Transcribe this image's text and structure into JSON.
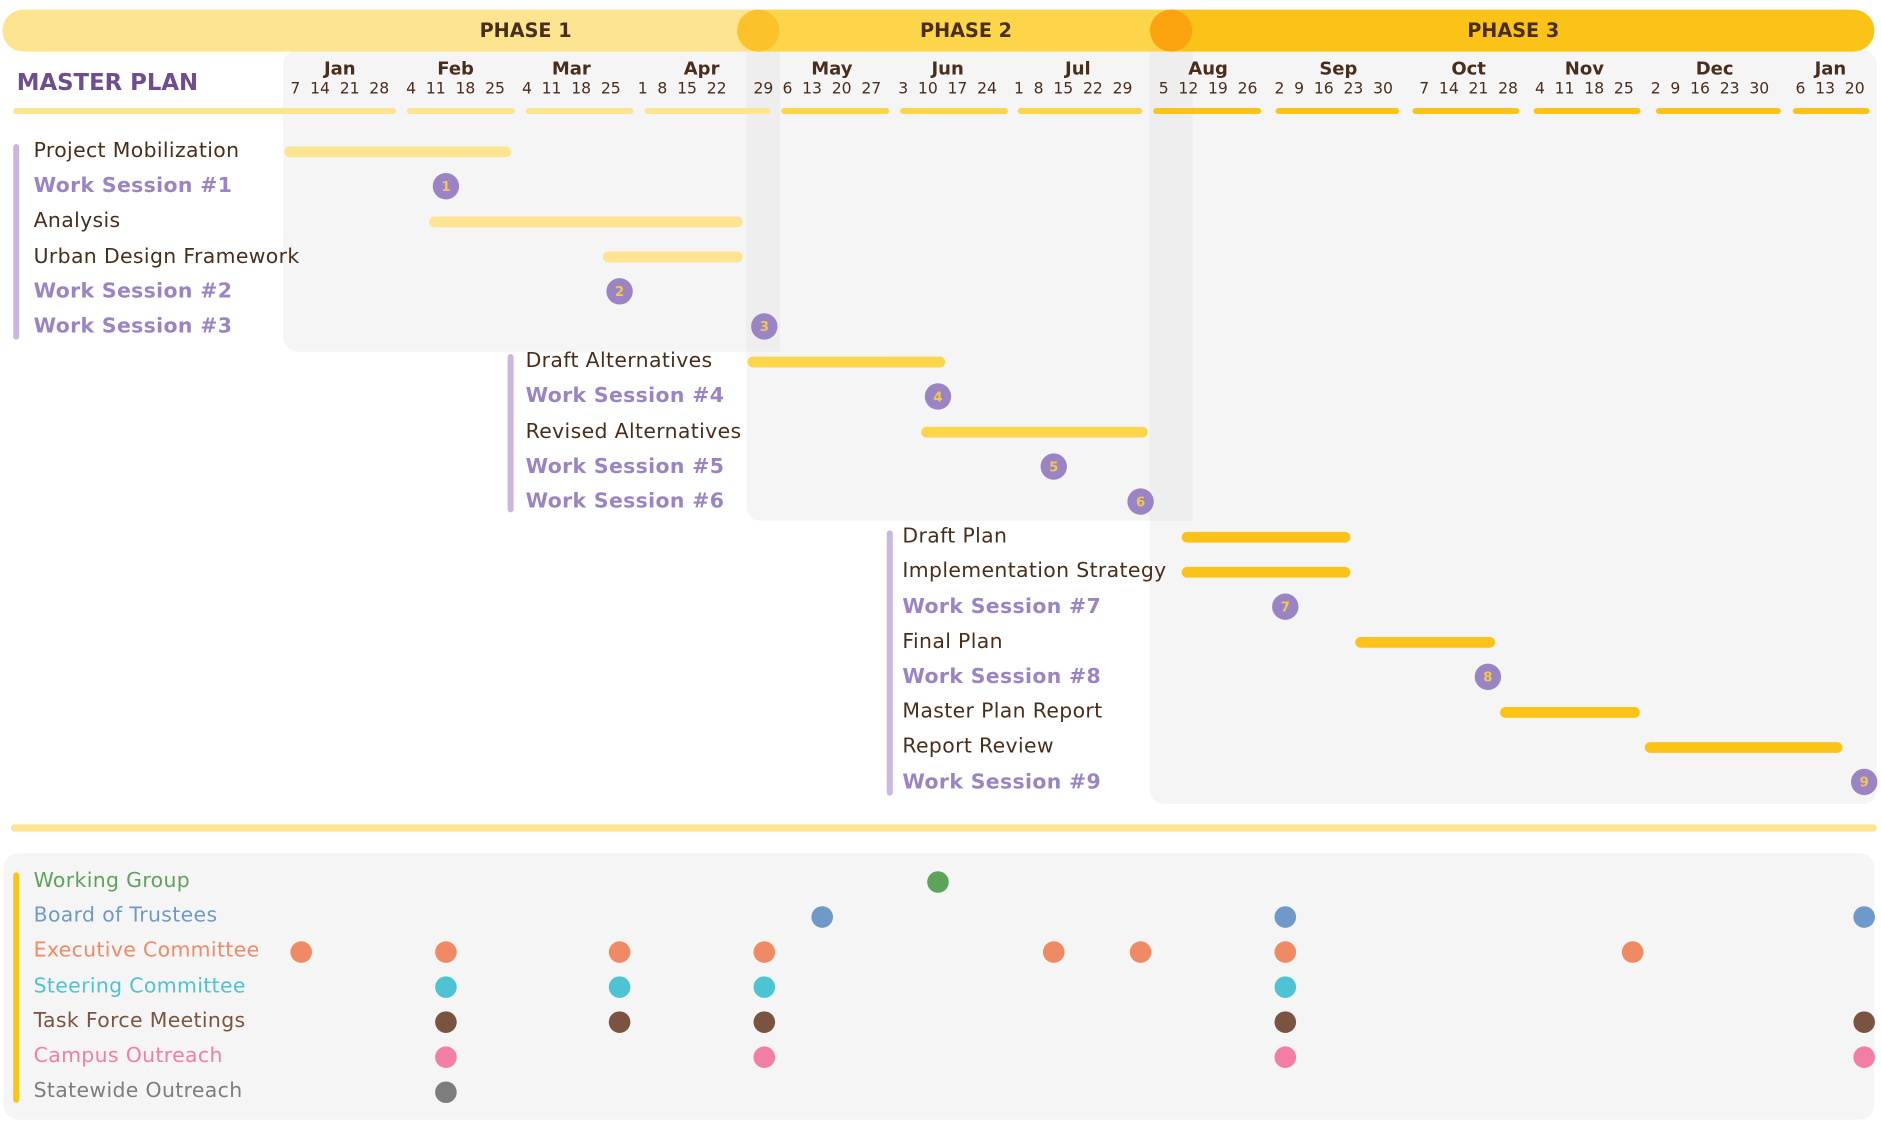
{
  "title": "MASTER PLAN",
  "phases": [
    {
      "label": "PHASE 1"
    },
    {
      "label": "PHASE 2"
    },
    {
      "label": "PHASE 3"
    }
  ],
  "months": [
    "Jan",
    "Feb",
    "Mar",
    "Apr",
    "May",
    "Jun",
    "Jul",
    "Aug",
    "Sep",
    "Oct",
    "Nov",
    "Dec",
    "Jan"
  ],
  "weeks": [
    "7 14 21 28",
    "4 11 18 25",
    "4 11 18 25",
    "1 8 15 22",
    "29",
    "6 13 20 27",
    "3 10 17 24",
    "1 8 15 22 29",
    "5 12 19 26",
    "2 9 16 23 30",
    "7 14 21 28",
    "4 11 18 25",
    "2 9 16 23 30",
    "6 13 20"
  ],
  "colors": {
    "phase1": "#fde490",
    "phase2": "#fcd54a",
    "phase3": "#fbc218",
    "work_session": "#9b84c4",
    "task_text": "#4a2e1c",
    "panel": "#f5f5f5"
  },
  "chart_data": [
    {
      "type": "gantt",
      "time_axis": "weeks",
      "tasks": [
        {
          "name": "Project Mobilization",
          "kind": "task",
          "phase": 1,
          "start": "Jan 7",
          "end": "Feb 25"
        },
        {
          "name": "Work Session #1",
          "kind": "session",
          "phase": 1,
          "date": "Feb 11",
          "number": "1"
        },
        {
          "name": "Analysis",
          "kind": "task",
          "phase": 1,
          "start": "Feb 11",
          "end": "Apr 22"
        },
        {
          "name": "Urban Design Framework",
          "kind": "task",
          "phase": 1,
          "start": "Mar 25",
          "end": "Apr 22"
        },
        {
          "name": "Work Session #2",
          "kind": "session",
          "phase": 1,
          "date": "Mar 25",
          "number": "2"
        },
        {
          "name": "Work Session #3",
          "kind": "session",
          "phase": 1,
          "date": "Apr 29",
          "number": "3"
        },
        {
          "name": "Draft Alternatives",
          "kind": "task",
          "phase": 2,
          "start": "Apr 29",
          "end": "Jun 10"
        },
        {
          "name": "Work Session #4",
          "kind": "session",
          "phase": 2,
          "date": "Jun 10",
          "number": "4"
        },
        {
          "name": "Revised Alternatives",
          "kind": "task",
          "phase": 2,
          "start": "Jun 10",
          "end": "Jul 29"
        },
        {
          "name": "Work Session #5",
          "kind": "session",
          "phase": 2,
          "date": "Jul 8",
          "number": "5"
        },
        {
          "name": "Work Session #6",
          "kind": "session",
          "phase": 2,
          "date": "Jul 29",
          "number": "6"
        },
        {
          "name": "Draft Plan",
          "kind": "task",
          "phase": 3,
          "start": "Aug 12",
          "end": "Sep 16"
        },
        {
          "name": "Implementation Strategy",
          "kind": "task",
          "phase": 3,
          "start": "Aug 12",
          "end": "Sep 16"
        },
        {
          "name": "Work Session #7",
          "kind": "session",
          "phase": 3,
          "date": "Sep 2",
          "number": "7"
        },
        {
          "name": "Final Plan",
          "kind": "task",
          "phase": 3,
          "start": "Sep 23",
          "end": "Oct 21"
        },
        {
          "name": "Work Session #8",
          "kind": "session",
          "phase": 3,
          "date": "Oct 21",
          "number": "8"
        },
        {
          "name": "Master Plan Report",
          "kind": "task",
          "phase": 3,
          "start": "Oct 28",
          "end": "Nov 25"
        },
        {
          "name": "Report Review",
          "kind": "task",
          "phase": 3,
          "start": "Dec 2",
          "end": "Jan 13"
        },
        {
          "name": "Work Session #9",
          "kind": "session",
          "phase": 3,
          "date": "Jan 20",
          "number": "9"
        }
      ]
    },
    {
      "type": "scatter",
      "series": [
        {
          "name": "Working Group",
          "color": "#5ea35a",
          "dates": [
            "Jun 10"
          ]
        },
        {
          "name": "Board of Trustees",
          "color": "#6e99c8",
          "dates": [
            "May 13",
            "Sep 2",
            "Jan 20"
          ]
        },
        {
          "name": "Executive Committee",
          "color": "#f08a64",
          "dates": [
            "Jan 7",
            "Feb 11",
            "Mar 25",
            "Apr 29",
            "Jul 8",
            "Jul 29",
            "Sep 2",
            "Nov 25"
          ]
        },
        {
          "name": "Steering Committee",
          "color": "#4ec3d3",
          "dates": [
            "Feb 11",
            "Mar 25",
            "Apr 29",
            "Sep 2"
          ]
        },
        {
          "name": "Task Force Meetings",
          "color": "#7b5441",
          "dates": [
            "Feb 11",
            "Mar 25",
            "Apr 29",
            "Sep 2",
            "Jan 20"
          ]
        },
        {
          "name": "Campus Outreach",
          "color": "#f27ea3",
          "dates": [
            "Feb 11",
            "Apr 29",
            "Sep 2",
            "Jan 20"
          ]
        },
        {
          "name": "Statewide Outreach",
          "color": "#7d7d7d",
          "dates": [
            "Feb 11"
          ]
        }
      ]
    }
  ]
}
